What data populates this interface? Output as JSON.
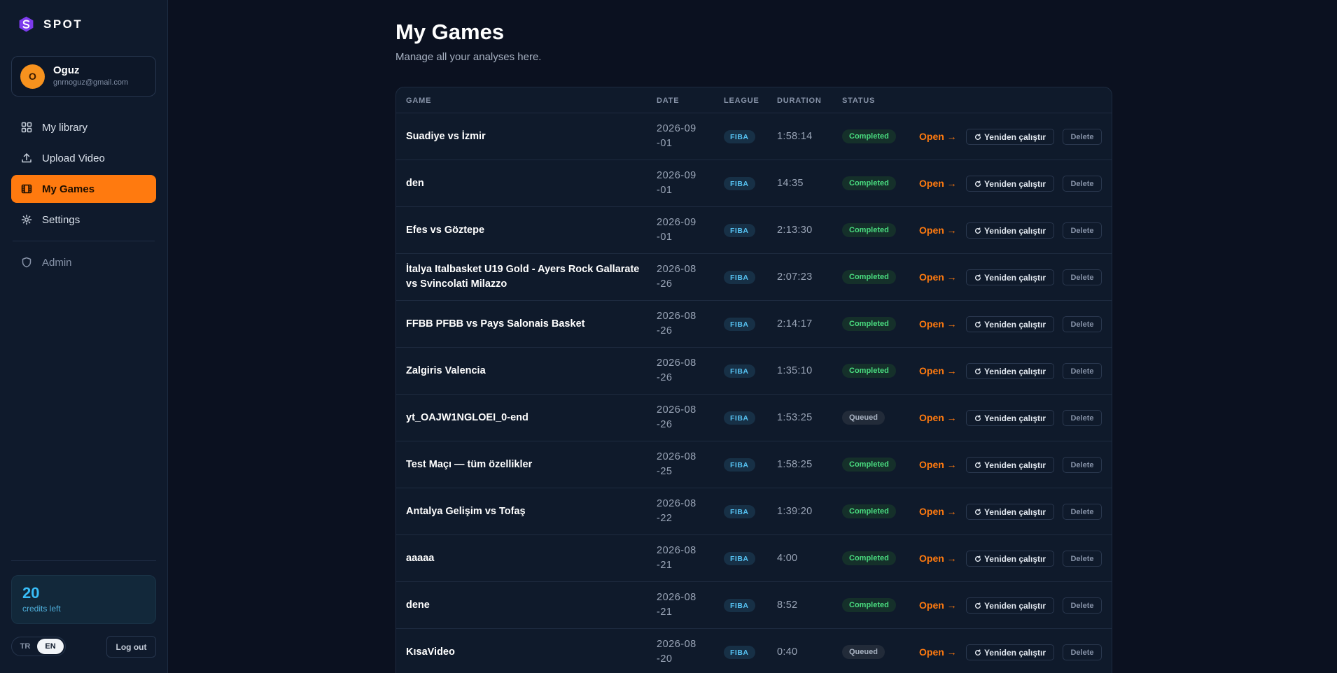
{
  "brand": {
    "name": "SPOT"
  },
  "user": {
    "initial": "O",
    "name": "Oguz",
    "email": "gnrnoguz@gmail.com"
  },
  "nav": {
    "items": [
      {
        "label": "My library",
        "icon": "grid-icon"
      },
      {
        "label": "Upload Video",
        "icon": "upload-icon"
      },
      {
        "label": "My Games",
        "icon": "film-icon",
        "active": true
      },
      {
        "label": "Settings",
        "icon": "gear-icon"
      }
    ],
    "admin": {
      "label": "Admin",
      "icon": "shield-icon"
    }
  },
  "credits": {
    "count": "20",
    "label": "credits left"
  },
  "language": {
    "options": [
      "TR",
      "EN"
    ],
    "selected": "EN"
  },
  "logout_label": "Log out",
  "page": {
    "title": "My Games",
    "subtitle": "Manage all your analyses here."
  },
  "table": {
    "headers": [
      "GAME",
      "DATE",
      "LEAGUE",
      "DURATION",
      "STATUS"
    ],
    "open_label": "Open →",
    "rerun_label": "Yeniden çalıştır",
    "delete_label": "Delete",
    "rows": [
      {
        "game": "Suadiye vs İzmir",
        "date": "2026-09-01",
        "league": "FIBA",
        "duration": "1:58:14",
        "status": "Completed"
      },
      {
        "game": "den",
        "date": "2026-09-01",
        "league": "FIBA",
        "duration": "14:35",
        "status": "Completed"
      },
      {
        "game": "Efes vs Göztepe",
        "date": "2026-09-01",
        "league": "FIBA",
        "duration": "2:13:30",
        "status": "Completed"
      },
      {
        "game": "İtalya Italbasket U19 Gold - Ayers Rock Gallarate vs Svincolati Milazzo",
        "date": "2026-08-26",
        "league": "FIBA",
        "duration": "2:07:23",
        "status": "Completed"
      },
      {
        "game": "FFBB PFBB vs Pays Salonais Basket",
        "date": "2026-08-26",
        "league": "FIBA",
        "duration": "2:14:17",
        "status": "Completed"
      },
      {
        "game": "Zalgiris Valencia",
        "date": "2026-08-26",
        "league": "FIBA",
        "duration": "1:35:10",
        "status": "Completed"
      },
      {
        "game": "yt_OAJW1NGLOEI_0-end",
        "date": "2026-08-26",
        "league": "FIBA",
        "duration": "1:53:25",
        "status": "Queued"
      },
      {
        "game": "Test Maçı — tüm özellikler",
        "date": "2026-08-25",
        "league": "FIBA",
        "duration": "1:58:25",
        "status": "Completed"
      },
      {
        "game": "Antalya Gelişim vs Tofaş",
        "date": "2026-08-22",
        "league": "FIBA",
        "duration": "1:39:20",
        "status": "Completed"
      },
      {
        "game": "aaaaa",
        "date": "2026-08-21",
        "league": "FIBA",
        "duration": "4:00",
        "status": "Completed"
      },
      {
        "game": "dene",
        "date": "2026-08-21",
        "league": "FIBA",
        "duration": "8:52",
        "status": "Completed"
      },
      {
        "game": "KısaVideo",
        "date": "2026-08-20",
        "league": "FIBA",
        "duration": "0:40",
        "status": "Queued"
      }
    ]
  }
}
